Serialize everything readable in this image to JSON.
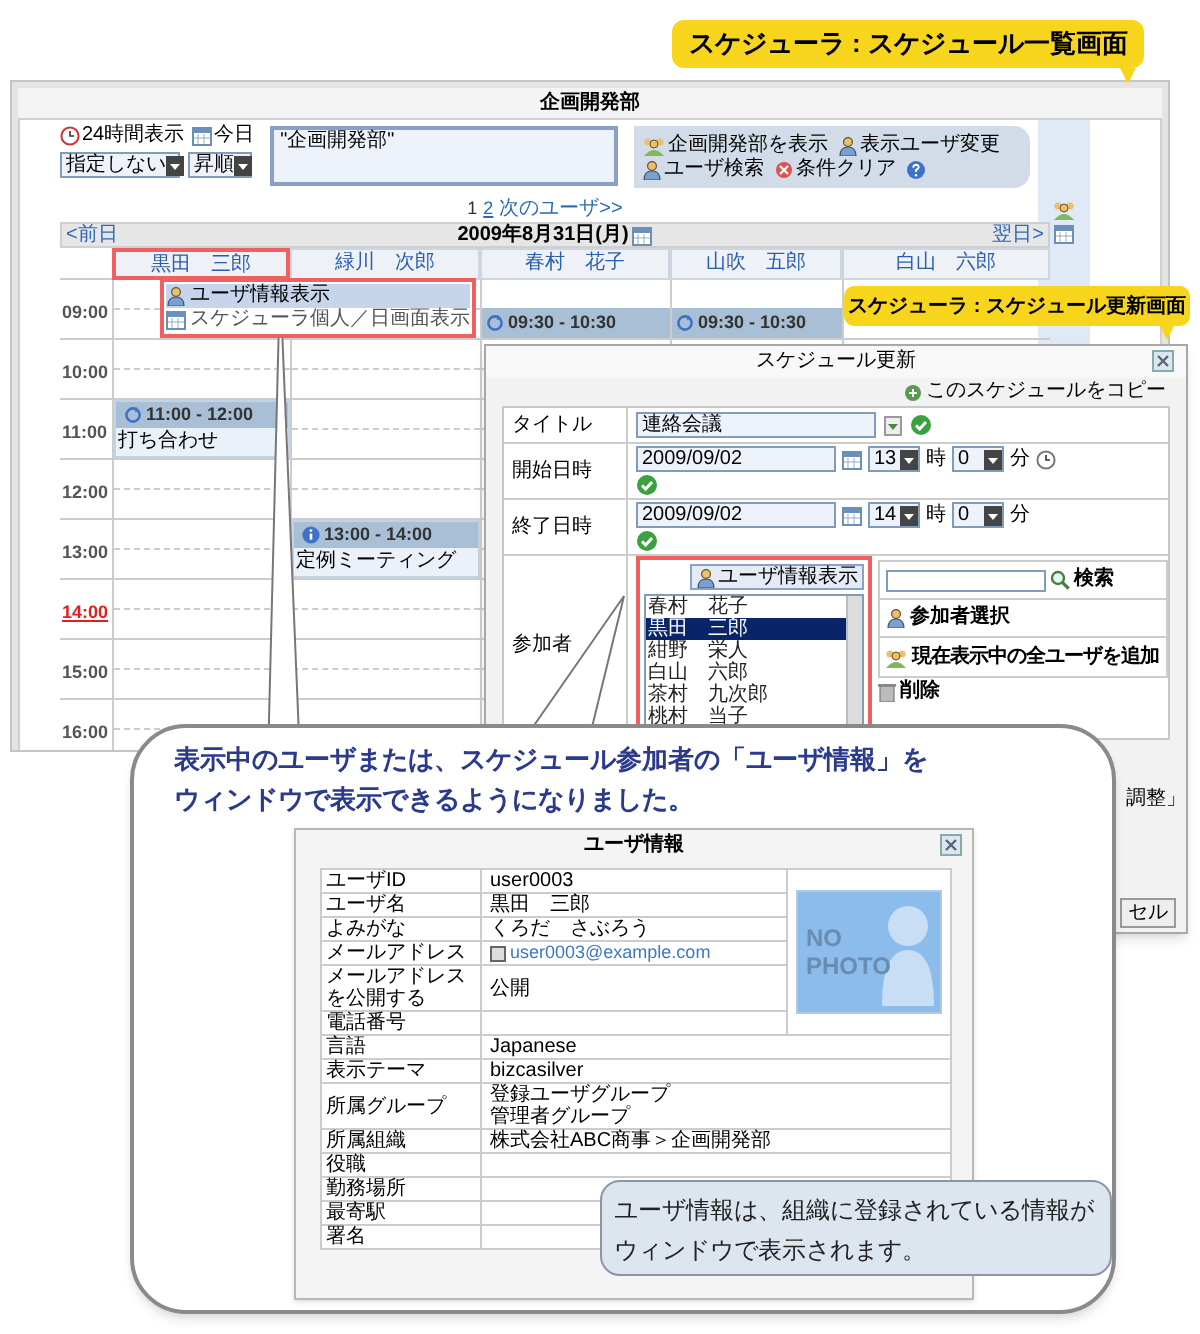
{
  "list_screen_label": "スケジューラ : スケジュール一覧画面",
  "scheduler": {
    "title": "企画開発部",
    "view_24h": "24時間表示",
    "today": "今日",
    "filter_select": "指定しない",
    "order_select": "昇順",
    "group_field": "\"企画開発部\"",
    "actions": [
      {
        "label": "企画開発部を表示",
        "kind": "group"
      },
      {
        "label": "表示ユーザ変更",
        "kind": "user"
      },
      {
        "label": "ユーザ検索",
        "kind": "search"
      },
      {
        "label": "条件クリア",
        "kind": "clear"
      }
    ],
    "pages": [
      {
        "label": "1",
        "selected": true
      },
      {
        "label": "2",
        "selected": false
      }
    ],
    "next_users": "次のユーザ>>",
    "prev_day": "<前日",
    "date": "2009年8月31日(月)",
    "next_day": "翌日>",
    "users": [
      {
        "name": "黒田　三郎",
        "selected": true
      },
      {
        "name": "緑川　次郎",
        "selected": false
      },
      {
        "name": "春村　花子",
        "selected": false
      },
      {
        "name": "山吹　五郎",
        "selected": false
      },
      {
        "name": "白山　六郎",
        "selected": false
      }
    ],
    "context_menu": [
      {
        "label": "ユーザ情報表示",
        "selected": true,
        "kind": "user"
      },
      {
        "label": "スケジューラ個人／日画面表示",
        "selected": false,
        "kind": "calendar"
      }
    ],
    "time_rows": [
      {
        "time": "09:00",
        "current": false,
        "cells": [
          {},
          {},
          {
            "event": {
              "time": "09:30 - 10:30",
              "half_hour": true,
              "kind": "repeat"
            }
          },
          {
            "event": {
              "time": "09:30 - 10:30",
              "half_hour": true,
              "kind": "repeat"
            }
          },
          {}
        ]
      },
      {
        "time": "10:00",
        "current": false,
        "cells": [
          {},
          {},
          {},
          {},
          {}
        ]
      },
      {
        "time": "11:00",
        "current": false,
        "cells": [
          {
            "event": {
              "time": "11:00 - 12:00",
              "title": "打ち合わせ",
              "half_hour": false,
              "kind": "repeat"
            }
          },
          {},
          {},
          {},
          {}
        ]
      },
      {
        "time": "12:00",
        "current": false,
        "cells": [
          {},
          {},
          {},
          {},
          {}
        ]
      },
      {
        "time": "13:00",
        "current": false,
        "cells": [
          {},
          {
            "event": {
              "time": "13:00 - 14:00",
              "title": "定例ミーティング",
              "half_hour": false,
              "kind": "info"
            }
          },
          {},
          {},
          {}
        ]
      },
      {
        "time": "14:00",
        "current": true,
        "cells": [
          {},
          {},
          {},
          {},
          {}
        ]
      },
      {
        "time": "15:00",
        "current": false,
        "cells": [
          {},
          {},
          {},
          {},
          {}
        ]
      },
      {
        "time": "16:00",
        "current": false,
        "cells": [
          {},
          {},
          {},
          {},
          {}
        ]
      }
    ]
  },
  "update_screen_label": "スケジューラ : スケジュール更新画面",
  "update_dialog": {
    "title": "スケジュール更新",
    "copy_link": "このスケジュールをコピー",
    "fields": [
      {
        "label": "タイトル",
        "kind": "text",
        "value": "連絡会議"
      },
      {
        "label": "開始日時",
        "kind": "datetime",
        "date": "2009/09/02",
        "hour": "13",
        "hour_unit": "時",
        "minute": "0",
        "minute_unit": "分",
        "clock": true
      },
      {
        "label": "終了日時",
        "kind": "datetime",
        "date": "2009/09/02",
        "hour": "14",
        "hour_unit": "時",
        "minute": "0",
        "minute_unit": "分",
        "clock": false
      }
    ],
    "participants_label": "参加者",
    "user_info_button": "ユーザ情報表示",
    "participants": [
      {
        "name": "春村　花子",
        "selected": false
      },
      {
        "name": "黒田　三郎",
        "selected": true
      },
      {
        "name": "紺野　栄人",
        "selected": false
      },
      {
        "name": "白山　六郎",
        "selected": false
      },
      {
        "name": "茶村　九次郎",
        "selected": false
      },
      {
        "name": "桃村　当子",
        "selected": false
      }
    ],
    "search_button": "検索",
    "select_participants": "参加者選択",
    "add_all_users": "現在表示中の全ユーザを追加",
    "delete": "削除",
    "partial_text": "調整」",
    "partial_button": "セル"
  },
  "callout": {
    "lines": [
      "表示中のユーザまたは、スケジュール参加者の「ユーザ情報」を",
      "ウィンドウで表示できるようになりました。"
    ],
    "user_info_window": {
      "title": "ユーザ情報",
      "photo_text": [
        "NO",
        "PHOTO"
      ],
      "rows": [
        {
          "label": "ユーザID",
          "kind": "text",
          "value": "user0003"
        },
        {
          "label": "ユーザ名",
          "kind": "text",
          "value": "黒田　三郎"
        },
        {
          "label": "よみがな",
          "kind": "text",
          "value": "くろだ　さぶろう"
        },
        {
          "label": "メールアドレス",
          "kind": "email",
          "value": "user0003@example.com"
        },
        {
          "label": "メールアドレスを公開する",
          "kind": "text",
          "value": "公開"
        },
        {
          "label": "電話番号",
          "kind": "text"
        },
        {
          "label": "言語",
          "kind": "text",
          "value": "Japanese"
        },
        {
          "label": "表示テーマ",
          "kind": "text",
          "value": "bizcasilver"
        },
        {
          "label": "所属グループ",
          "kind": "multi",
          "values": [
            "登録ユーザグループ",
            "管理者グループ"
          ]
        },
        {
          "label": "所属組織",
          "kind": "text",
          "value": "株式会社ABC商事＞企画開発部"
        },
        {
          "label": "役職",
          "kind": "text"
        },
        {
          "label": "勤務場所",
          "kind": "text"
        },
        {
          "label": "最寄駅",
          "kind": "text"
        },
        {
          "label": "署名",
          "kind": "text"
        }
      ]
    }
  },
  "note": {
    "lines": [
      "ユーザ情報は、組織に登録されている情報が",
      "ウィンドウで表示されます。"
    ]
  }
}
